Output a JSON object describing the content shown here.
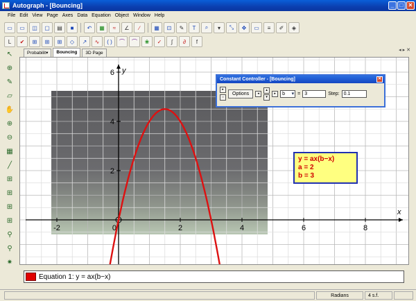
{
  "window": {
    "title": "Autograph - [Bouncing]"
  },
  "menu": [
    "File",
    "Edit",
    "View",
    "Page",
    "Axes",
    "Data",
    "Equation",
    "Object",
    "Window",
    "Help"
  ],
  "page_tabs": [
    "Probabilit",
    "Bouncing",
    "3D Page"
  ],
  "graph": {
    "x_axis_label": "x",
    "y_axis_label": "y",
    "x_ticks": [
      "-2",
      "0",
      "2",
      "4",
      "6",
      "8"
    ],
    "y_ticks": [
      "2",
      "4",
      "6"
    ],
    "curve_color": "#dd1111",
    "equation_box": {
      "line1": "y = ax(b−x)",
      "line2": "a = 2",
      "line3": "b = 3"
    }
  },
  "constant_controller": {
    "title": "Constant Controller - [Bouncing]",
    "options_label": "Options",
    "variable": "b",
    "equals": "=",
    "value": "3",
    "step_label": "Step:",
    "step_value": "0.1"
  },
  "legend": {
    "label": "Equation 1: y = ax(b−x)",
    "color": "#e00000"
  },
  "status": {
    "mode": "Radians",
    "sig_figs": "4 s.f."
  },
  "chart_data": {
    "type": "line",
    "equation": "y = ax(b-x)",
    "a": 2,
    "b": 3,
    "xlabel": "x",
    "ylabel": "y",
    "xlim": [
      -3,
      9
    ],
    "ylim": [
      -1.7,
      6.5
    ],
    "grid": true,
    "x_tick_values": [
      -2,
      0,
      2,
      4,
      6,
      8
    ],
    "y_tick_values": [
      2,
      4,
      6
    ]
  }
}
